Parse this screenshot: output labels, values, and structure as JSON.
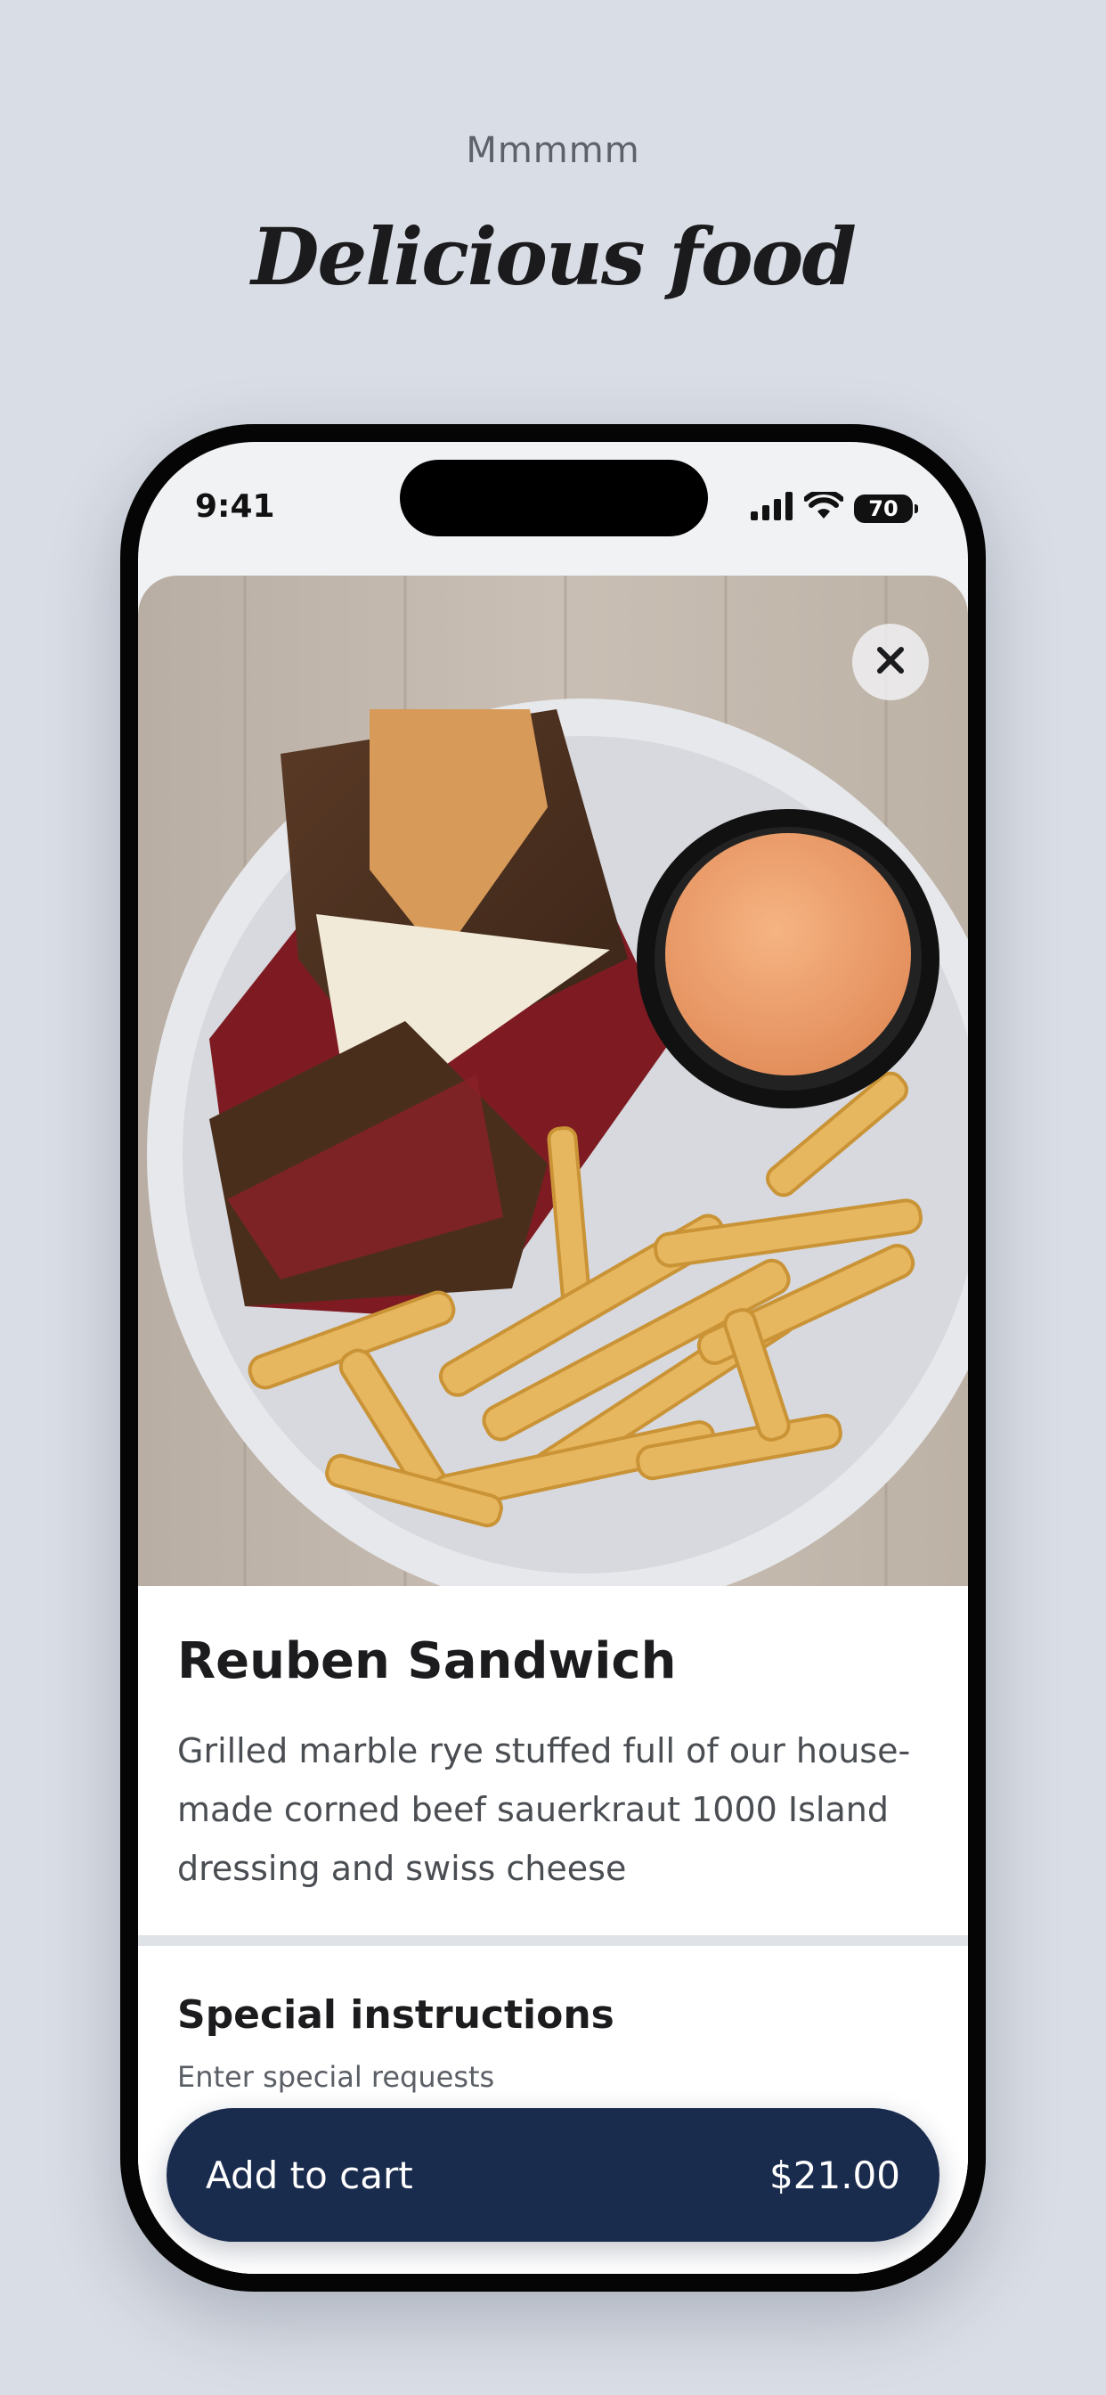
{
  "page": {
    "pretitle": "Mmmmm",
    "title": "Delicious food"
  },
  "statusbar": {
    "time": "9:41",
    "battery": "70",
    "icons": [
      "signal-icon",
      "wifi-icon",
      "battery-icon"
    ]
  },
  "item": {
    "name": "Reuben Sandwich",
    "description": "Grilled marble rye stuffed full of our house-made corned beef sauerkraut 1000 Island dressing and swiss cheese"
  },
  "special": {
    "title": "Special instructions",
    "placeholder": "Enter special requests"
  },
  "cart": {
    "label": "Add to cart",
    "price": "$21.00"
  },
  "colors": {
    "background": "#d9dde5",
    "button": "#1a2c4e",
    "divider": "#dfe2e7"
  }
}
